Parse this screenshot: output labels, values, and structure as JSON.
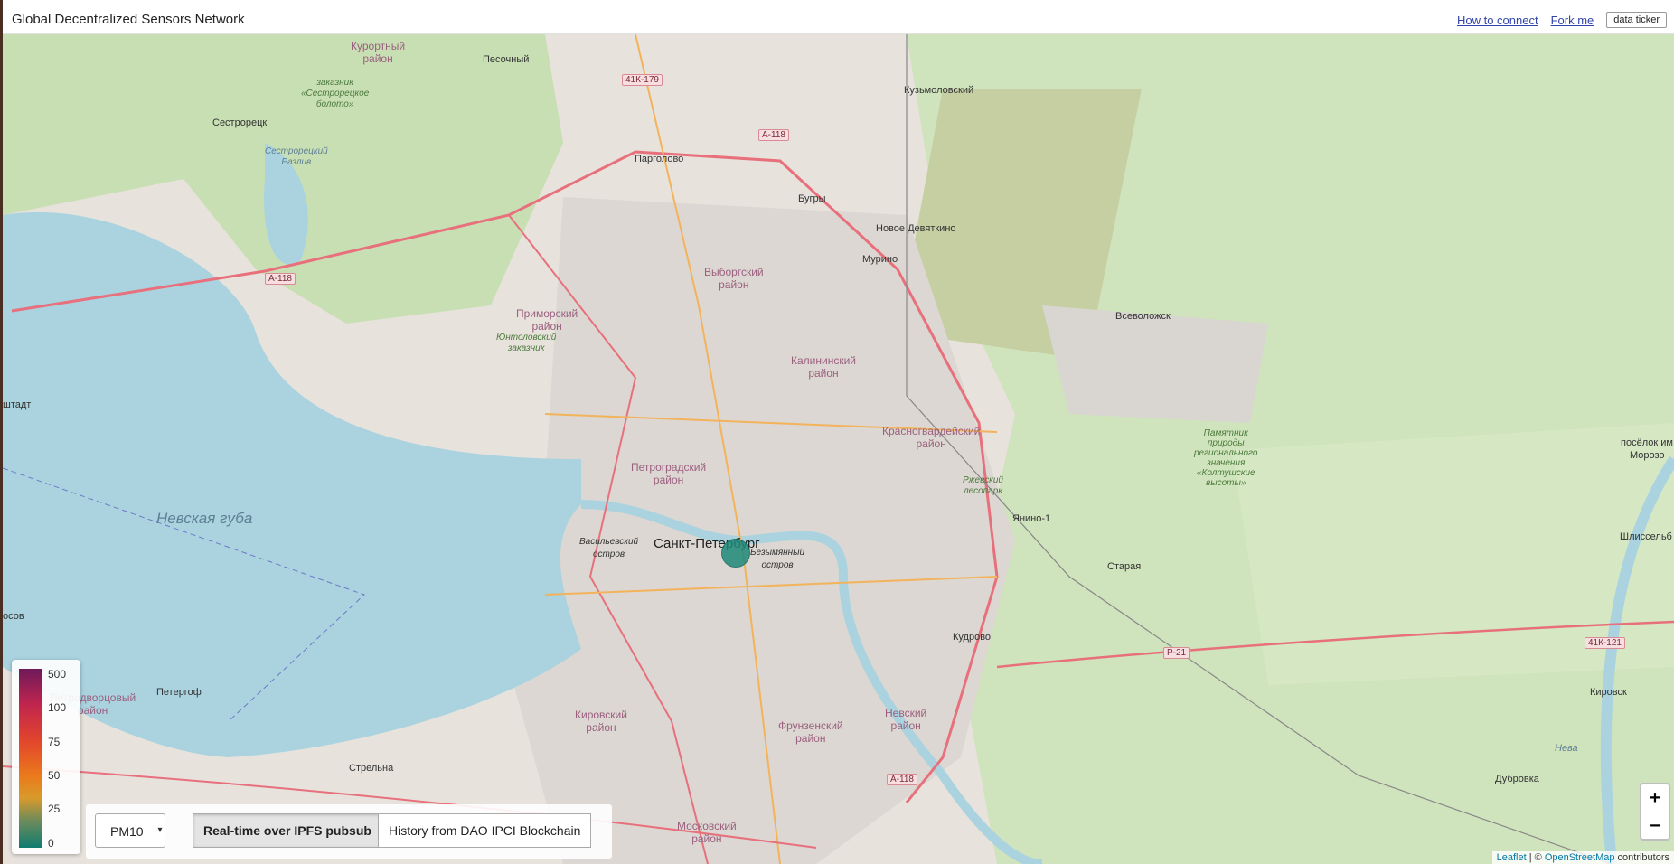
{
  "header": {
    "title": "Global Decentralized Sensors Network",
    "how_to_connect": "How to connect",
    "fork_me": "Fork me",
    "data_ticker": "data ticker"
  },
  "map": {
    "water_label": "Невская губа",
    "city_label": "Санкт-Петербург",
    "places": {
      "sestroretsk": "Сестрорецк",
      "pesochny": "Песочный",
      "pargolovo": "Парголово",
      "bugry": "Бугры",
      "kuzmolovsky": "Кузьмоловский",
      "novoe_devyatkino": "Новое Девяткино",
      "murino": "Мурино",
      "vsevolozhsk": "Всеволожск",
      "yanino": "Янино-1",
      "staraya": "Старая",
      "kudrovo": "Кудрово",
      "peterhof": "Петергоф",
      "strelna": "Стрельна",
      "dubrovka": "Дубровка",
      "kirovsk": "Кировск",
      "shlisselburg": "Шлиссельб",
      "poselok": "посёлок им",
      "morozova": "Морозо",
      "stadt": "штадт",
      "nosov": "осов",
      "neva": "Нева"
    },
    "districts": {
      "kurortny": "Курортный\nрайон",
      "vyborgsky": "Выборгский\nрайон",
      "primorsky": "Приморский\nрайон",
      "kalininsky": "Калининский\nрайон",
      "krasnogvardeysky": "Красногвардейский\nрайон",
      "petrogradsky": "Петроградский\nрайон",
      "vasileostrovsky": "Васильевский\nостров",
      "bezymyanny": "Безымянный\nостров",
      "kirovsky": "Кировский\nрайон",
      "frunzensky": "Фрунзенский\nрайон",
      "nevsky": "Невский\nрайон",
      "moskovsky": "Московский\nрайон",
      "petrodvortsovy": "Петродворцовый\nрайон"
    },
    "nature": {
      "sestroretsk_swamp": "заказник\n«Сестрорецкое\nболото»",
      "sestroretsk_razliv": "Сестрорецкий\nРазлив",
      "yuntolovsky": "Юнтоловский\nзаказник",
      "rzhevsky": "Ржевский\nлесопарк",
      "koltushi": "Памятник\nприроды\nрегионального\nзначения\n«Колтушские\nвысоты»"
    },
    "roads": {
      "r1": "41К-179",
      "r2": "А-118",
      "r3": "А-118",
      "r4": "Р-21",
      "r5": "41К-121",
      "r6": "А-118"
    }
  },
  "legend": {
    "ticks": [
      "500",
      "100",
      "75",
      "50",
      "25",
      "0"
    ]
  },
  "controls": {
    "metric": "PM10",
    "realtime_label": "Real-time over IPFS pubsub",
    "history_label": "History from DAO IPCI Blockchain"
  },
  "zoom": {
    "in": "+",
    "out": "−"
  },
  "attribution": {
    "leaflet": "Leaflet",
    "sep": " | © ",
    "osm": "OpenStreetMap",
    "contributors": " contributors"
  },
  "colors": {
    "water": "#aad3df",
    "marker": "#1e8a7a",
    "forest": "#add19e",
    "urban": "#dcd7d2"
  }
}
